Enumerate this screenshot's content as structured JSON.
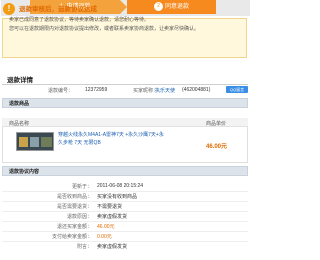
{
  "steps": {
    "step1": "1. 申请退款",
    "step2_num": "2",
    "step2": "同意退款"
  },
  "notice": {
    "title": "退款审核后，退款协议达成",
    "line1": "卖家已成同意了退款协议，等待卖家确认退款，请您耐心等待。",
    "line2": "您可以在退款期限内对退款协议提出修改，或者联系卖家协商退款，让卖家尽快确认。"
  },
  "details": {
    "title": "退款详情",
    "refund_no_label": "退款编号：",
    "refund_no": "12372959",
    "buyer_label": "买家昵称：",
    "buyer_name": "执乐天使",
    "buyer_qq": "(462004881)",
    "contact_button": "QQ留言"
  },
  "goods": {
    "title": "退款商品",
    "col_name": "商品名称",
    "col_price": "商品单价",
    "description": "穿越火线永久M4A1-A雷神7天 +永久沙鹰7天+永久步枪 7天 无限QB",
    "price": "46.00元"
  },
  "agreement": {
    "title": "退款协议内容",
    "rows": [
      {
        "label": "更新于：",
        "value": "2011-06-08 20:15:24"
      },
      {
        "label": "是否收到商品：",
        "value": "买家没有收到商品"
      },
      {
        "label": "是否需要退货：",
        "value": "不需要退货"
      },
      {
        "label": "退款原因：",
        "value": "卖家虚假发货"
      },
      {
        "label": "退还买家金额：",
        "value": "46.00元"
      },
      {
        "label": "支付给卖家金额：",
        "value": "0.00元"
      },
      {
        "label": "附言：",
        "value": "卖家虚假发货"
      }
    ]
  },
  "colors": {
    "accent_orange": "#f68a1f",
    "link_blue": "#1a5fb4",
    "price_orange": "#e06a00"
  }
}
